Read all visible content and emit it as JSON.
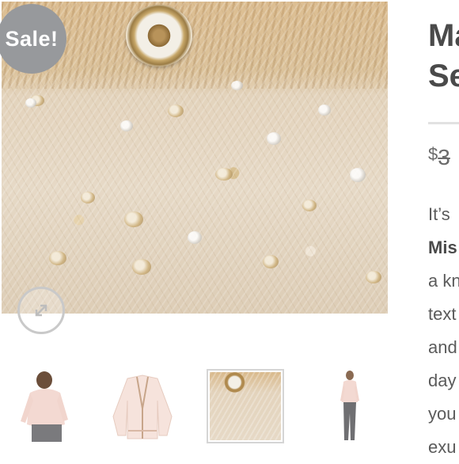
{
  "product": {
    "title_lines": [
      "Ma",
      "Se"
    ],
    "currency": "$",
    "old_price": "3",
    "description_lines": [
      "It’s",
      "Mis",
      "a kn",
      "text",
      "and",
      "day",
      "you",
      "exu"
    ]
  },
  "badge": {
    "sale_label": "Sale!"
  },
  "gallery": {
    "zoom_icon": "expand-arrows-icon",
    "thumbnails": [
      {
        "name": "model-front-view",
        "active": false
      },
      {
        "name": "cardigan-flat-lay",
        "active": false
      },
      {
        "name": "sequin-detail",
        "active": true
      },
      {
        "name": "model-full-length",
        "active": false
      }
    ]
  },
  "colors": {
    "badge_bg": "#97999c",
    "title_text": "#4a4a4a",
    "body_text": "#5b5b5b"
  }
}
